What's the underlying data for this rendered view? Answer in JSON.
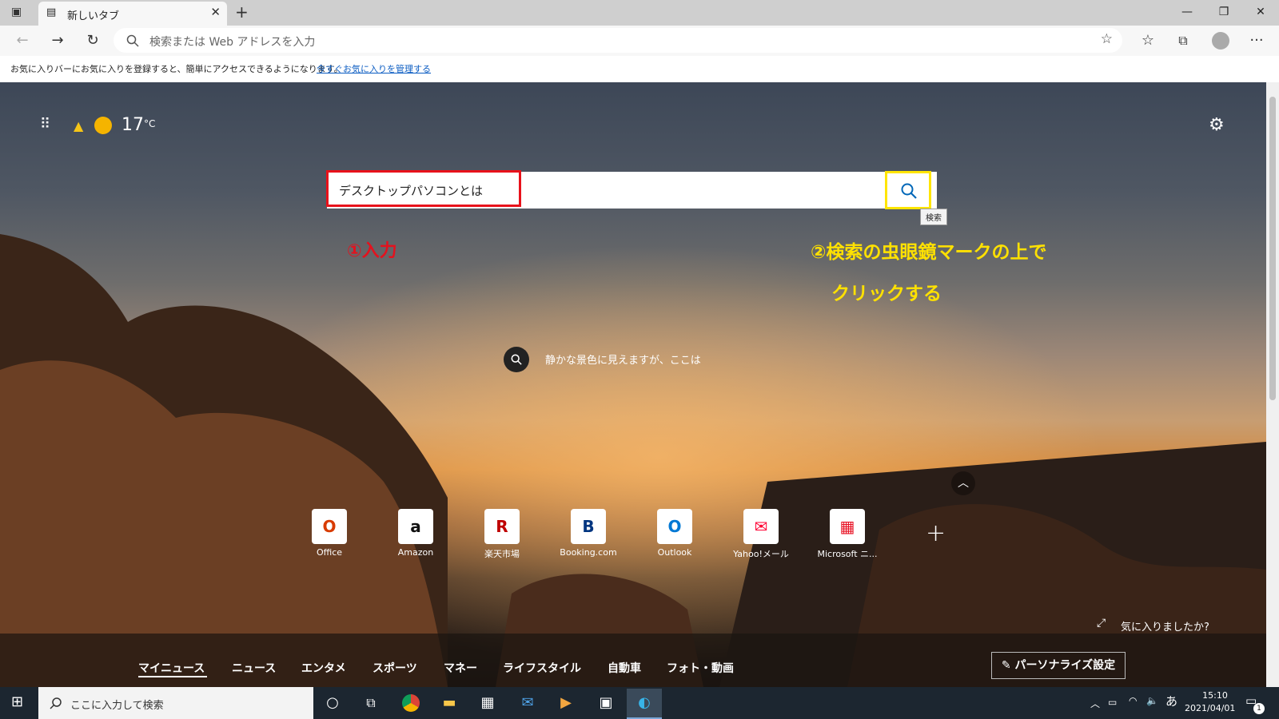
{
  "browser": {
    "tab_title": "新しいタブ",
    "address_placeholder": "検索または Web アドレスを入力"
  },
  "favorites_bar": {
    "message": "お気に入りバーにお気に入りを登録すると、簡単にアクセスできるようになります。",
    "link": "今すぐお気に入りを管理する"
  },
  "page": {
    "temperature": "17",
    "temp_unit": "°C",
    "search_query": "デスクトップパソコンとは",
    "search_tooltip": "検索",
    "fact_text": "静かな景色に見えますが、ここは",
    "feedback": "気に入りましたか?",
    "personalize": "パーソナライズ設定"
  },
  "annotations": {
    "step1": "①入力",
    "step2_line1": "②検索の虫眼鏡マークの上で",
    "step2_line2": "クリックする"
  },
  "quick_links": [
    {
      "label": "Office",
      "icon": "office-icon",
      "glyph": "O",
      "color": "#d83b01"
    },
    {
      "label": "Amazon",
      "icon": "amazon-icon",
      "glyph": "a",
      "color": "#111111"
    },
    {
      "label": "楽天市場",
      "icon": "rakuten-icon",
      "glyph": "R",
      "color": "#bf0000"
    },
    {
      "label": "Booking.com",
      "icon": "booking-icon",
      "glyph": "B",
      "color": "#003580"
    },
    {
      "label": "Outlook",
      "icon": "outlook-icon",
      "glyph": "O",
      "color": "#0078d4"
    },
    {
      "label": "Yahoo!メール",
      "icon": "yahoo-mail-icon",
      "glyph": "✉",
      "color": "#ff0033"
    },
    {
      "label": "Microsoft ニ...",
      "icon": "msn-icon",
      "glyph": "▦",
      "color": "#e81123"
    }
  ],
  "news_tabs": [
    "マイニュース",
    "ニュース",
    "エンタメ",
    "スポーツ",
    "マネー",
    "ライフスタイル",
    "自動車",
    "フォト・動画"
  ],
  "taskbar": {
    "search_placeholder": "ここに入力して検索",
    "ime": "あ",
    "time": "15:10",
    "date": "2021/04/01",
    "notification_count": "1"
  }
}
